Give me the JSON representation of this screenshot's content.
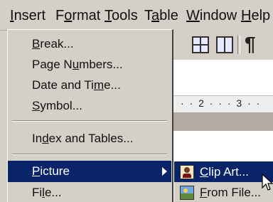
{
  "menubar": {
    "items": [
      {
        "label_pre": "",
        "label_key": "I",
        "label_post": "nsert"
      },
      {
        "label_pre": "F",
        "label_key": "o",
        "label_post": "rmat"
      },
      {
        "label_pre": "",
        "label_key": "T",
        "label_post": "ools"
      },
      {
        "label_pre": "T",
        "label_key": "a",
        "label_post": "ble"
      },
      {
        "label_pre": "",
        "label_key": "W",
        "label_post": "indow"
      },
      {
        "label_pre": "",
        "label_key": "H",
        "label_post": "elp"
      }
    ]
  },
  "insert_menu": {
    "items": [
      {
        "pre": "",
        "key": "B",
        "post": "reak..."
      },
      {
        "pre": "Page N",
        "key": "u",
        "post": "mbers..."
      },
      {
        "pre": "Date and Ti",
        "key": "m",
        "post": "e..."
      },
      {
        "pre": "",
        "key": "S",
        "post": "ymbol..."
      },
      {
        "pre": "In",
        "key": "d",
        "post": "ex and Tables..."
      },
      {
        "pre": "",
        "key": "P",
        "post": "icture"
      },
      {
        "pre": "Fi",
        "key": "l",
        "post": "e..."
      }
    ]
  },
  "picture_submenu": {
    "items": [
      {
        "pre": "",
        "key": "C",
        "post": "lip Art...",
        "icon": "clip-art-icon"
      },
      {
        "pre": "",
        "key": "F",
        "post": "rom File...",
        "icon": "from-file-icon"
      }
    ]
  },
  "ruler": {
    "text": "· · 2 · · · 3 · ·"
  },
  "colors": {
    "menu_bg": "#d4d0c8",
    "highlight": "#0a246a",
    "highlight_text": "#ffffff"
  }
}
